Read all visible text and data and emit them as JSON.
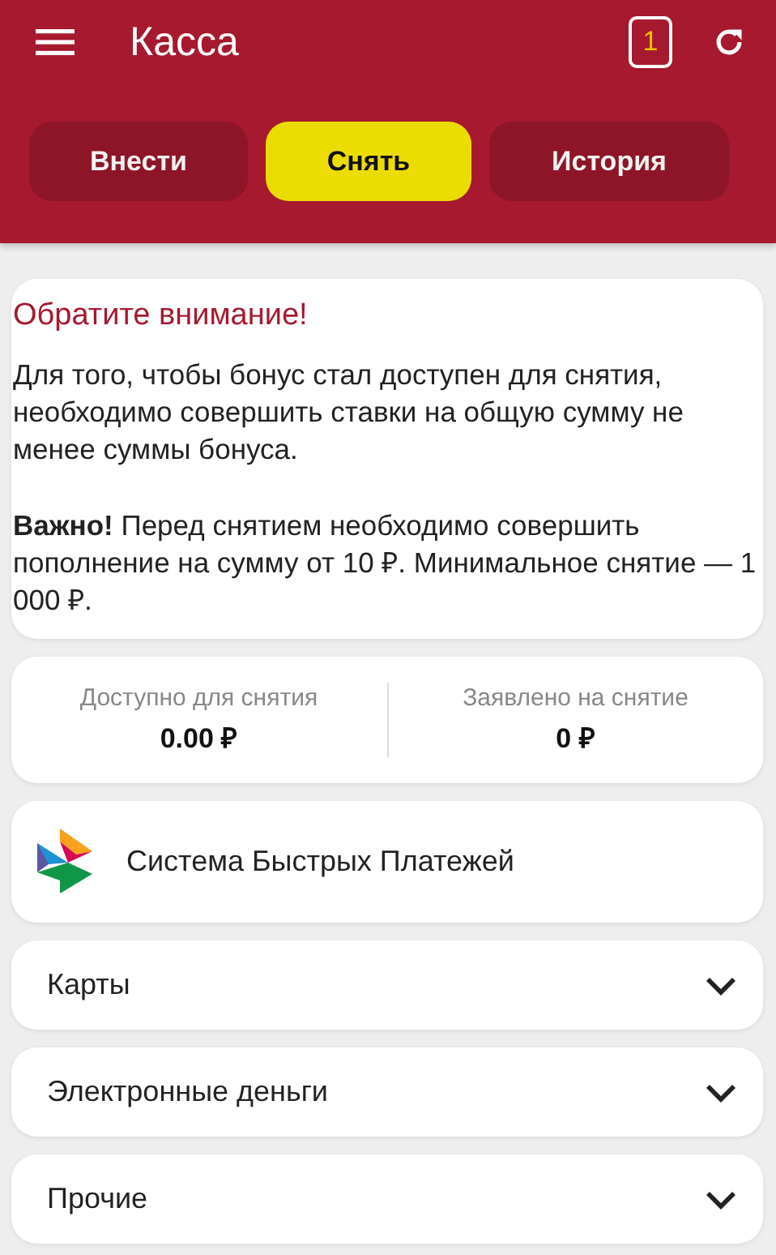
{
  "app_bar": {
    "title": "Касса",
    "ticket_count": "1"
  },
  "tabs": [
    {
      "label": "Внести",
      "selected": false
    },
    {
      "label": "Снять",
      "selected": true
    },
    {
      "label": "История",
      "selected": false
    }
  ],
  "notice": {
    "title": "Обратите внимание!",
    "paragraphs": [
      "Для того, чтобы бонус стал доступен для снятия, необходимо совершить ставки на общую сумму не менее суммы бонуса.",
      "**Важно!** Перед снятием необходимо совершить пополнение на сумму от 10 ₽. Минимальное снятие — 1 000 ₽."
    ]
  },
  "balances": [
    {
      "label": "Доступно для снятия",
      "value": "0.00 ₽"
    },
    {
      "label": "Заявлено на снятие",
      "value": "0 ₽"
    }
  ],
  "methods": [
    {
      "kind": "sbp",
      "label": "Система Быстрых Платежей"
    },
    {
      "kind": "category",
      "label": "Карты",
      "expanded": false
    },
    {
      "kind": "category",
      "label": "Электронные деньги",
      "expanded": false
    },
    {
      "kind": "category",
      "label": "Прочие",
      "expanded": false
    }
  ]
}
